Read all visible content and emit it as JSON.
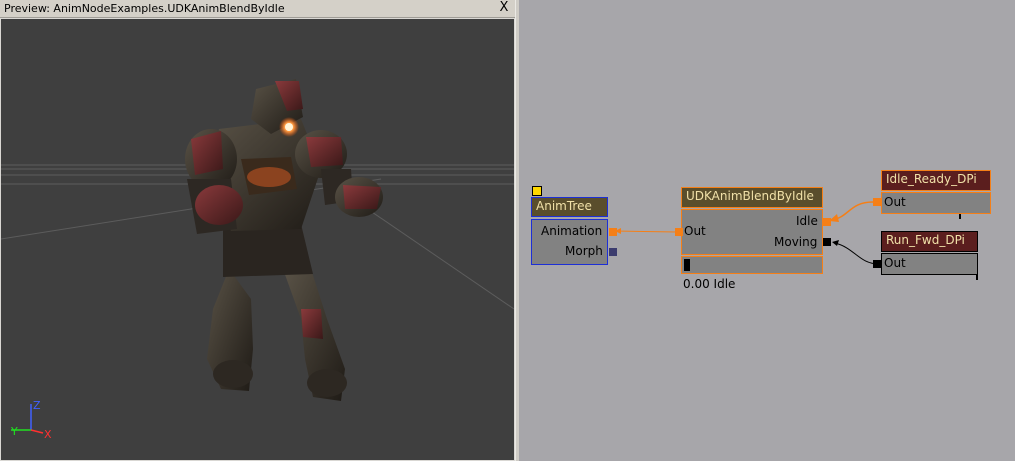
{
  "preview": {
    "title": "Preview: AnimNodeExamples.UDKAnimBlendByIdle",
    "close_label": "X",
    "axis": {
      "z": "Z",
      "y": "Y",
      "x": "X"
    }
  },
  "graph": {
    "anim_tree": {
      "title": "AnimTree",
      "inputs": [
        "Animation",
        "Morph"
      ]
    },
    "blend_node": {
      "title": "UDKAnimBlendByIdle",
      "out_label": "Out",
      "inputs": [
        "Idle",
        "Moving"
      ],
      "status": "0.00 Idle",
      "weight": 0.0
    },
    "seq_idle": {
      "title": "Idle_Ready_DPi",
      "out_label": "Out"
    },
    "seq_run": {
      "title": "Run_Fwd_DPi",
      "out_label": "Out"
    }
  },
  "colors": {
    "viewport_bg": "#3f3f3f",
    "graph_bg": "#a7a6aa",
    "node_body": "#828282",
    "selected_orange": "#f57f17",
    "anim_tree_blue": "#1d2fd6",
    "sequence_title": "#5b1e1e",
    "title_text_light": "#f0e0a8"
  }
}
